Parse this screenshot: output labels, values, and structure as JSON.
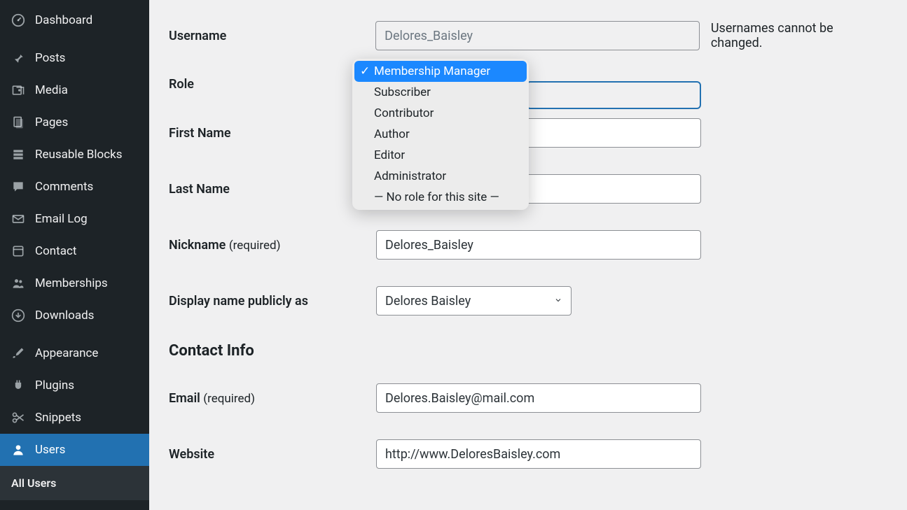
{
  "sidebar": {
    "items": [
      {
        "id": "dashboard",
        "label": "Dashboard",
        "icon": "dashboard"
      },
      {
        "id": "posts",
        "label": "Posts",
        "icon": "pin"
      },
      {
        "id": "media",
        "label": "Media",
        "icon": "media"
      },
      {
        "id": "pages",
        "label": "Pages",
        "icon": "pages"
      },
      {
        "id": "reusable-blocks",
        "label": "Reusable Blocks",
        "icon": "blocks"
      },
      {
        "id": "comments",
        "label": "Comments",
        "icon": "comment"
      },
      {
        "id": "email-log",
        "label": "Email Log",
        "icon": "envelope"
      },
      {
        "id": "contact",
        "label": "Contact",
        "icon": "contact"
      },
      {
        "id": "memberships",
        "label": "Memberships",
        "icon": "groups"
      },
      {
        "id": "downloads",
        "label": "Downloads",
        "icon": "download"
      },
      {
        "id": "appearance",
        "label": "Appearance",
        "icon": "brush"
      },
      {
        "id": "plugins",
        "label": "Plugins",
        "icon": "plug"
      },
      {
        "id": "snippets",
        "label": "Snippets",
        "icon": "scissors"
      },
      {
        "id": "users",
        "label": "Users",
        "icon": "user",
        "current": true
      }
    ],
    "submenu": {
      "all_users": "All Users"
    }
  },
  "form": {
    "username_label": "Username",
    "username_value": "Delores_Baisley",
    "username_hint": "Usernames cannot be changed.",
    "role_label": "Role",
    "role_selected": "Membership Manager",
    "role_options": [
      "Membership Manager",
      "Subscriber",
      "Contributor",
      "Author",
      "Editor",
      "Administrator",
      "— No role for this site —"
    ],
    "first_name_label": "First Name",
    "first_name_value": "",
    "last_name_label": "Last Name",
    "last_name_value": "",
    "nickname_label": "Nickname",
    "nickname_required": "(required)",
    "nickname_value": "Delores_Baisley",
    "display_name_label": "Display name publicly as",
    "display_name_value": "Delores Baisley",
    "contact_info_heading": "Contact Info",
    "email_label": "Email",
    "email_required": "(required)",
    "email_value": "Delores.Baisley@mail.com",
    "website_label": "Website",
    "website_value": "http://www.DeloresBaisley.com"
  }
}
